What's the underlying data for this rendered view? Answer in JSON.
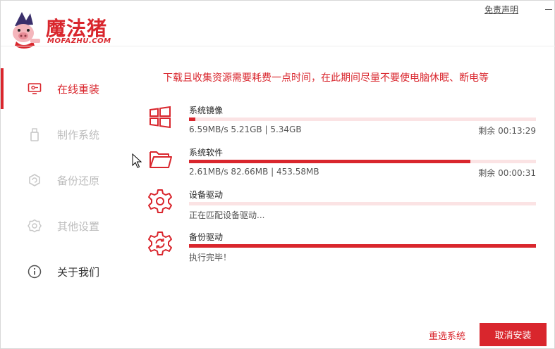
{
  "app": {
    "logo_text": "魔法猪",
    "logo_sub": "MOFAZHU.COM",
    "disclaimer": "免责声明",
    "accent": "#d9262d"
  },
  "sidebar": {
    "items": [
      {
        "label": "在线重装",
        "icon": "monitor-icon",
        "state": "active"
      },
      {
        "label": "制作系统",
        "icon": "usb-drive-icon",
        "state": "disabled"
      },
      {
        "label": "备份还原",
        "icon": "backup-restore-icon",
        "state": "disabled"
      },
      {
        "label": "其他设置",
        "icon": "gear-icon",
        "state": "disabled"
      },
      {
        "label": "关于我们",
        "icon": "info-icon",
        "state": "normal"
      }
    ]
  },
  "main": {
    "notice": "下载且收集资源需要耗费一点时间，在此期间尽量不要使电脑休眠、断电等",
    "tasks": [
      {
        "name": "系统镜像",
        "icon": "windows-icon",
        "progress": 0.018,
        "status": "6.59MB/s 5.21GB | 5.34GB",
        "remaining": "剩余 00:13:29"
      },
      {
        "name": "系统软件",
        "icon": "folder-icon",
        "progress": 0.81,
        "status": "2.61MB/s 82.66MB | 453.58MB",
        "remaining": "剩余 00:00:31"
      },
      {
        "name": "设备驱动",
        "icon": "gear-icon",
        "progress": 0.0,
        "status": "正在匹配设备驱动...",
        "remaining": ""
      },
      {
        "name": "备份驱动",
        "icon": "gear-refresh-icon",
        "progress": 1.0,
        "status": "执行完毕！",
        "remaining": ""
      }
    ]
  },
  "footer": {
    "reselect_label": "重选系统",
    "cancel_label": "取消安装"
  }
}
